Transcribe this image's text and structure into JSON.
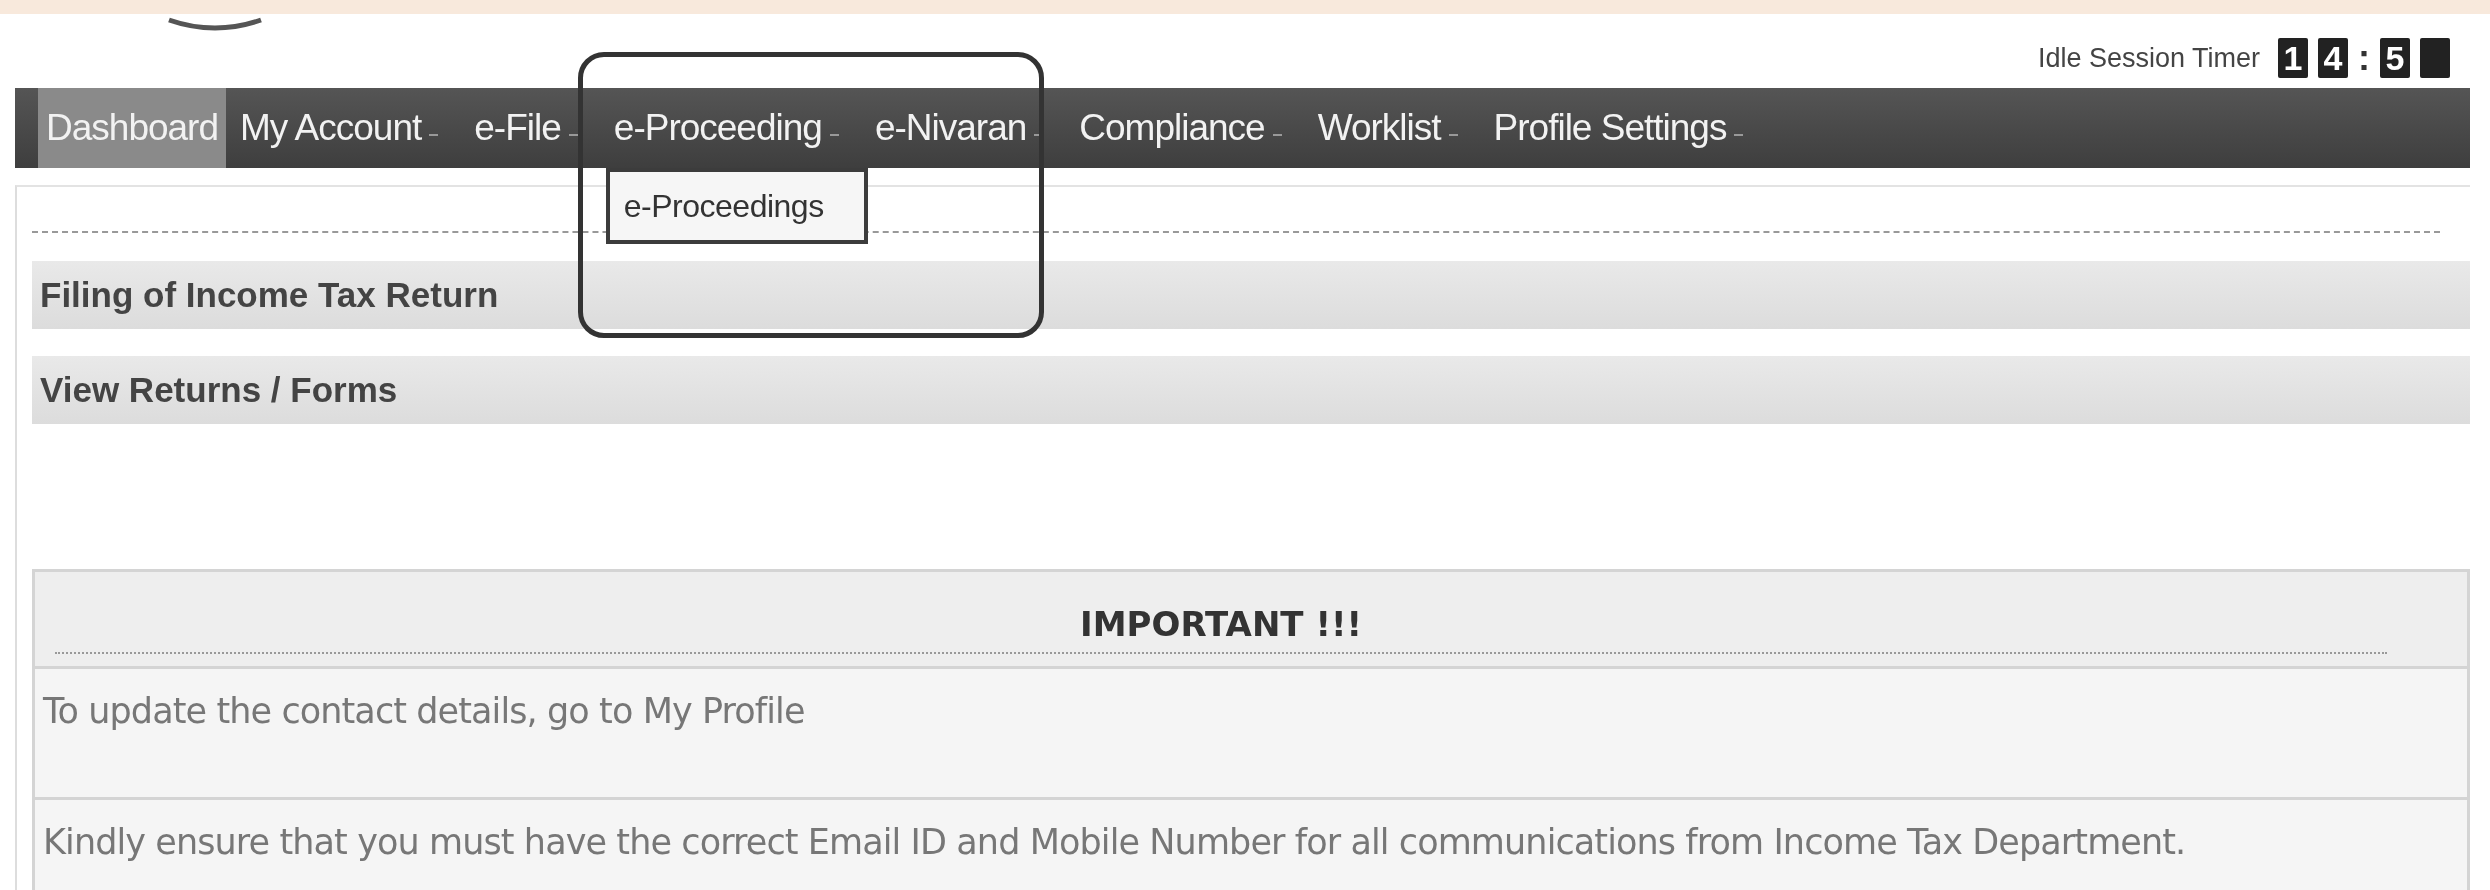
{
  "header": {
    "timer": {
      "label": "Idle Session Timer",
      "tiles": [
        {
          "kind": "digit",
          "text": "1"
        },
        {
          "kind": "digit",
          "text": "4"
        },
        {
          "kind": "colon",
          "text": ":"
        },
        {
          "kind": "digit",
          "text": "5"
        },
        {
          "kind": "blank"
        }
      ]
    }
  },
  "nav": {
    "items": [
      {
        "label": "Dashboard",
        "selected": true,
        "has_dropdown": false,
        "open": false
      },
      {
        "label": "My Account",
        "selected": false,
        "has_dropdown": true,
        "open": false
      },
      {
        "label": "e-File",
        "selected": false,
        "has_dropdown": true,
        "open": false
      },
      {
        "label": "e-Proceeding",
        "selected": false,
        "has_dropdown": true,
        "open": true,
        "highlighted": true,
        "submenu": [
          "e-Proceedings"
        ]
      },
      {
        "label": "e-Nivaran",
        "selected": false,
        "has_dropdown": true,
        "open": false
      },
      {
        "label": "Compliance",
        "selected": false,
        "has_dropdown": true,
        "open": false
      },
      {
        "label": "Worklist",
        "selected": false,
        "has_dropdown": true,
        "open": false
      },
      {
        "label": "Profile Settings",
        "selected": false,
        "has_dropdown": true,
        "open": false
      }
    ]
  },
  "sections": [
    "Filing of Income Tax Return",
    "View Returns / Forms"
  ],
  "notice": {
    "title": "IMPORTANT !!!",
    "lines": [
      "To update the contact details, go to My Profile",
      "Kindly ensure that you must have the correct Email ID and Mobile Number for all communications from Income Tax Department."
    ]
  }
}
